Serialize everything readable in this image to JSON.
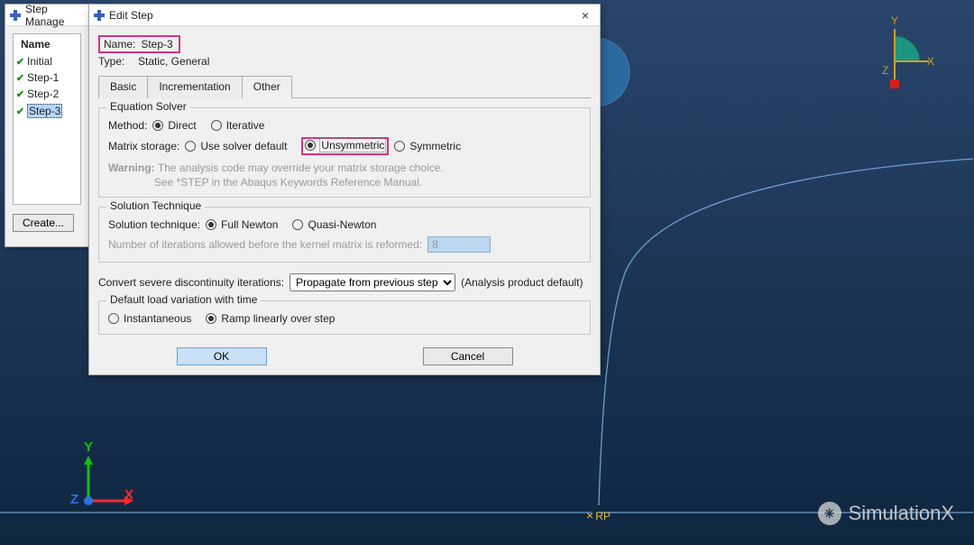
{
  "viewport": {
    "rp_label": "RP"
  },
  "step_manager": {
    "title": "Step Manage",
    "header": "Name",
    "items": [
      {
        "label": "Initial",
        "selected": false
      },
      {
        "label": "Step-1",
        "selected": false
      },
      {
        "label": "Step-2",
        "selected": false
      },
      {
        "label": "Step-3",
        "selected": true
      }
    ],
    "create_label": "Create..."
  },
  "edit": {
    "title": "Edit Step",
    "name_label": "Name:",
    "name_value": "Step-3",
    "type_label": "Type:",
    "type_value": "Static, General",
    "tabs": {
      "basic": "Basic",
      "inc": "Incrementation",
      "other": "Other"
    },
    "eq": {
      "legend": "Equation Solver",
      "method_label": "Method:",
      "method_opts": {
        "direct": "Direct",
        "iterative": "Iterative"
      },
      "matrix_label": "Matrix storage:",
      "matrix_opts": {
        "default": "Use solver default",
        "unsym": "Unsymmetric",
        "sym": "Symmetric"
      },
      "warn_label": "Warning:",
      "warn1": "The analysis code may override your matrix storage choice.",
      "warn2": "See *STEP in the Abaqus Keywords Reference Manual."
    },
    "sol": {
      "legend": "Solution Technique",
      "label": "Solution technique:",
      "opts": {
        "full": "Full Newton",
        "quasi": "Quasi-Newton"
      },
      "iter_label": "Number of iterations allowed before the kernel matrix is reformed:",
      "iter_value": "8"
    },
    "csdi_label": "Convert severe discontinuity iterations:",
    "csdi_value": "Propagate from previous step",
    "csdi_note": "(Analysis product default)",
    "load": {
      "legend": "Default load variation with time",
      "inst": "Instantaneous",
      "ramp": "Ramp linearly over step"
    },
    "ok": "OK",
    "cancel": "Cancel"
  },
  "triad": {
    "x": "X",
    "y": "Y",
    "z": "Z"
  },
  "watermark": "SimulationX"
}
